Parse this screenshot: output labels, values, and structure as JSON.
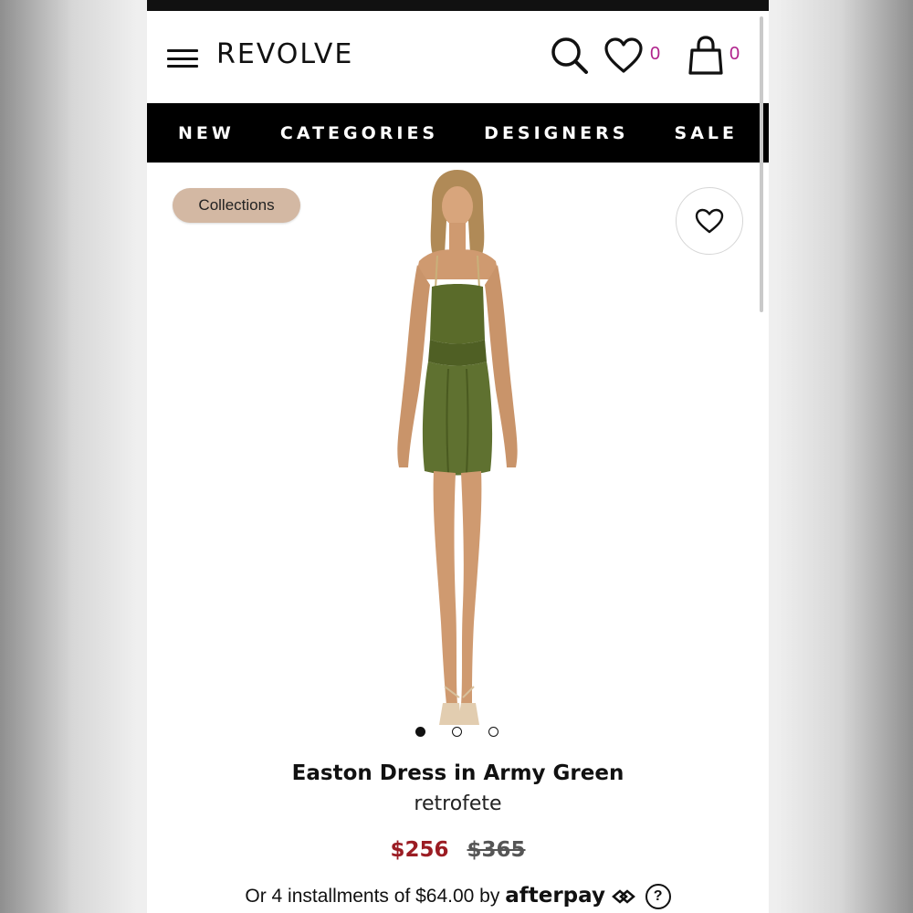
{
  "header": {
    "brand": "REVOLVE",
    "wishlist_count": "0",
    "bag_count": "0"
  },
  "nav": {
    "items": [
      "NEW",
      "CATEGORIES",
      "DESIGNERS",
      "SALE"
    ]
  },
  "badge": {
    "label": "Collections"
  },
  "gallery": {
    "total_images": 3,
    "active_index": 0
  },
  "product": {
    "name": "Easton Dress in Army Green",
    "designer": "retrofete",
    "sale_price": "$256",
    "original_price": "$365"
  },
  "payment": {
    "text": "Or 4 installments of $64.00 by",
    "provider": "afterpay",
    "help": "?"
  },
  "colors": {
    "sale_price": "#9b1c23",
    "count_accent": "#b0228c",
    "pill": "#d3b8a3",
    "dress": "#5a6b2a"
  }
}
